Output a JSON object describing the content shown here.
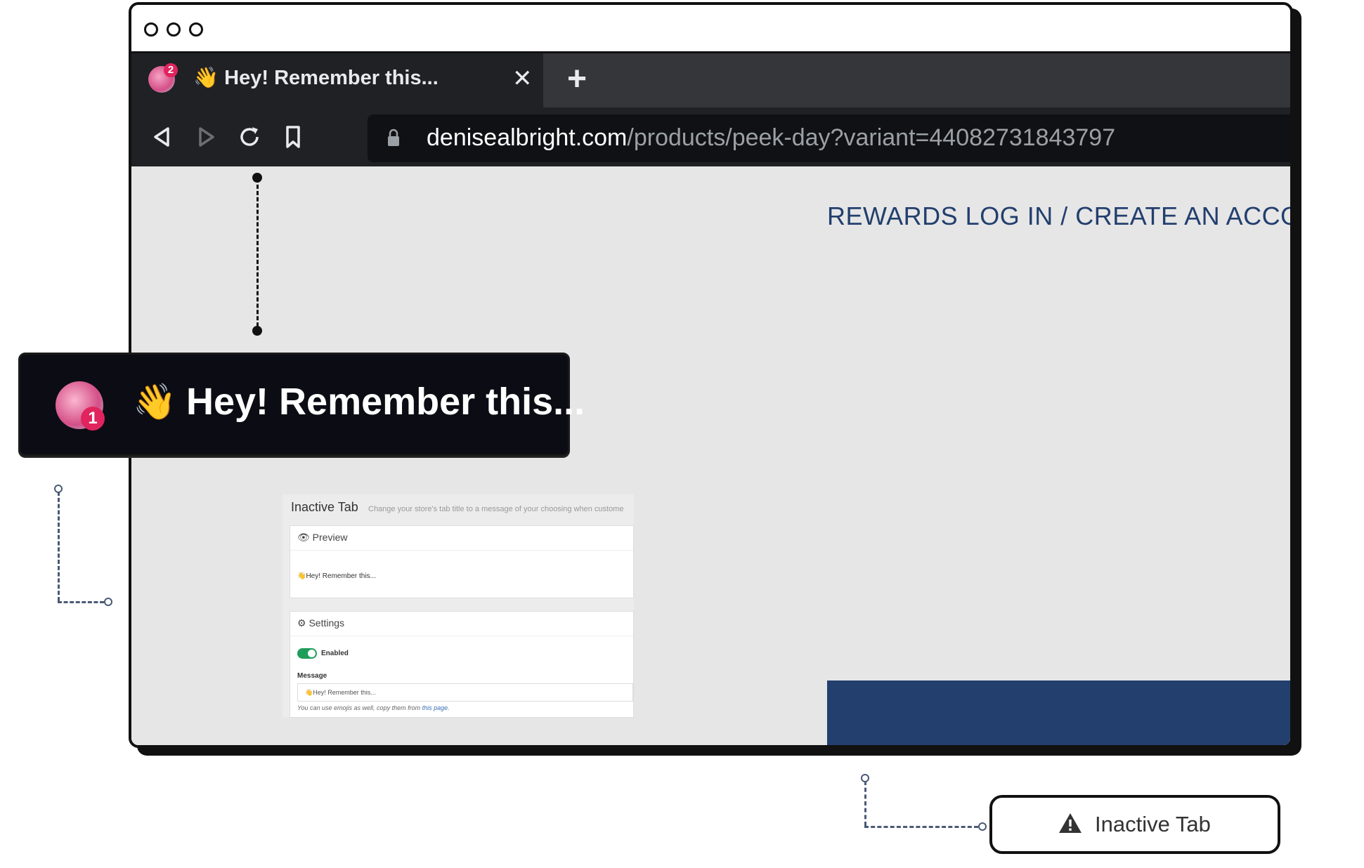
{
  "browser": {
    "tab": {
      "badge": "2",
      "emoji": "👋",
      "title": "Hey! Remember this...",
      "close": "✕"
    },
    "new_tab": "+",
    "address": {
      "host": "denisealbright.com",
      "path": "/products/peek-day?variant=44082731843797"
    }
  },
  "page": {
    "rewards_link": "REWARDS LOG IN / CREATE AN ACCO"
  },
  "callout": {
    "badge": "1",
    "emoji": "👋",
    "title": "Hey! Remember this..."
  },
  "panel": {
    "heading": "Inactive Tab",
    "description": "Change your store's tab title to a message of your choosing when custome",
    "preview": {
      "title": "Preview",
      "text": "👋Hey! Remember this..."
    },
    "settings": {
      "title": "Settings",
      "toggle_label": "Enabled",
      "message_label": "Message",
      "message_value": "👋Hey! Remember this...",
      "help_prefix": "You can use emojis as well, copy them from ",
      "help_link": "this page",
      "help_suffix": "."
    }
  },
  "badge_pill": {
    "label": "Inactive Tab"
  },
  "colors": {
    "chrome_dark": "#202124",
    "brand_navy": "#223f6e",
    "toggle_green": "#1e9e5a"
  }
}
